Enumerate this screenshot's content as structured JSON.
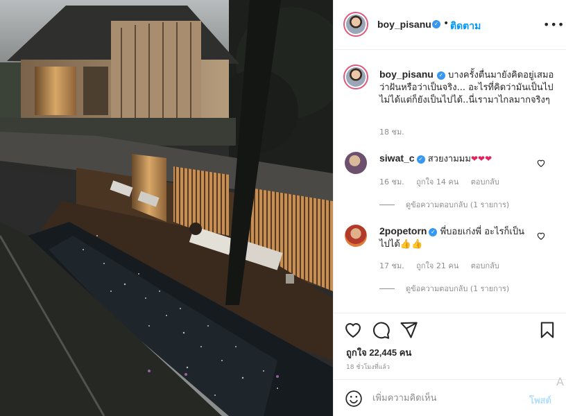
{
  "post": {
    "username": "boy_pisanu",
    "follow_label": "ติดตาม",
    "separator": "•",
    "more_icon": "more-options-icon",
    "caption": "บางครั้งตื่นมายังคิดอยู่เสมอว่าฝันหรือว่าเป็นจริง... อะไรที่คิดว่ามันเป็นไปไม่ได้แต่ก็ยังเป็นไปได้..นี่เรามาไกลมากจริงๆ",
    "caption_time": "18 ชม."
  },
  "comments": [
    {
      "username": "siwat_c",
      "text": "สวยงามมม",
      "emoji": "❤❤❤",
      "time": "16 ชม.",
      "likes": "ถูกใจ 14 คน",
      "reply_label": "ตอบกลับ",
      "view_replies": "ดูข้อความตอบกลับ (1 รายการ)"
    },
    {
      "username": "2popetorn",
      "text": "พี่บอยเก่งพี่ อะไรก็เป็นไปได้",
      "emoji": "👍👍",
      "time": "17 ชม.",
      "likes": "ถูกใจ 21 คน",
      "reply_label": "ตอบกลับ",
      "view_replies": "ดูข้อความตอบกลับ (1 รายการ)"
    }
  ],
  "actions": {
    "likes_text": "ถูกใจ 22,445 คน",
    "post_time": "18 ชั่วโมงที่แล้ว",
    "icons": [
      "heart-icon",
      "comment-icon",
      "share-icon",
      "bookmark-icon"
    ]
  },
  "add_comment": {
    "placeholder": "เพิ่มความคิดเห็น",
    "post_label": "โพสต์",
    "watermark": "A"
  },
  "colors": {
    "link_blue": "#0095f6",
    "post_button": "#b2dffc",
    "verified": "#3897f0",
    "meta_gray": "#8e8e8e"
  }
}
